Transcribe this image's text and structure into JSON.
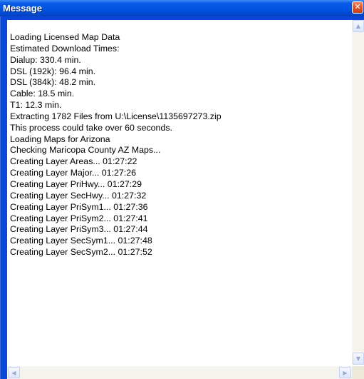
{
  "window": {
    "title": "Message"
  },
  "title_bar": {
    "close_glyph": "✕",
    "close_icon": "close-icon"
  },
  "log_lines": [
    "Loading Licensed Map Data",
    "Estimated Download Times:",
    "Dialup: 330.4 min.",
    "DSL (192k): 96.4 min.",
    "DSL (384k): 48.2 min.",
    "Cable: 18.5 min.",
    "T1: 12.3 min.",
    "Extracting 1782 Files from U:\\License\\1135697273.zip",
    "This process could take over 60 seconds.",
    "Loading Maps for Arizona",
    "Checking Maricopa County AZ Maps...",
    "Creating Layer Areas... 01:27:22",
    "Creating Layer Major... 01:27:26",
    "Creating Layer PriHwy... 01:27:29",
    "Creating Layer SecHwy... 01:27:32",
    "Creating Layer PriSym1... 01:27:36",
    "Creating Layer PriSym2... 01:27:41",
    "Creating Layer PriSym3... 01:27:44",
    "Creating Layer SecSym1... 01:27:48",
    "Creating Layer SecSym2... 01:27:52"
  ],
  "scrollbars": {
    "up_glyph": "▲",
    "down_glyph": "▼",
    "left_glyph": "◀",
    "right_glyph": "▶"
  },
  "colors": {
    "title_bar": "#0054e3",
    "close_button": "#e0572d",
    "window_frame": "#0a46d8",
    "text": "#000000",
    "background": "#ffffff"
  }
}
